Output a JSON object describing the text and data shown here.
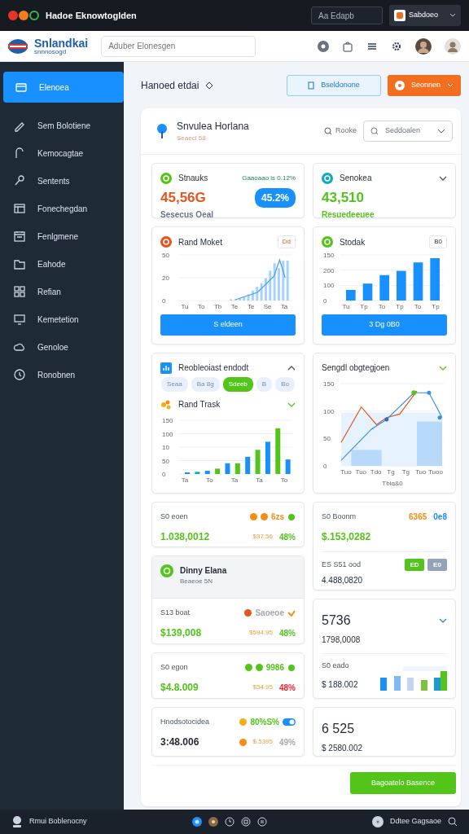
{
  "titlebar": {
    "title": "Hadoe Eknowtoglden",
    "search": {
      "placeholder": "Aa Edapb"
    },
    "account": "Sabdoeo"
  },
  "header": {
    "brand": "Snlandkai",
    "tagline": "snnnosogd",
    "search": {
      "placeholder": "Aduber Elonesgen"
    }
  },
  "sidebar": {
    "items": [
      {
        "label": "Elenoea",
        "selected": true
      },
      {
        "label": "Sem Bolotiene",
        "selected": false
      },
      {
        "label": "Kemocagtae",
        "selected": false
      },
      {
        "label": "Sentents",
        "selected": false
      },
      {
        "label": "Fonechegdan",
        "selected": false
      },
      {
        "label": "Fenlgmene",
        "selected": false
      },
      {
        "label": "Eahode",
        "selected": false
      },
      {
        "label": "Refian",
        "selected": false
      },
      {
        "label": "Kemetetion",
        "selected": false
      },
      {
        "label": "Genoloe",
        "selected": false
      },
      {
        "label": "Ronobnen",
        "selected": false
      }
    ]
  },
  "page": {
    "title": "Hanoed etdai",
    "secondary_button": "Bseldonone",
    "primary_button": "Seonnen"
  },
  "panel": {
    "title": "Snvulea Horlana",
    "subtitle": "Seaecl 58",
    "link": "Rooke",
    "select": "Seddoalen"
  },
  "stats": [
    {
      "title": "Stnauks",
      "color": "#52c41a",
      "note": "Gaaoaao is 0.12%",
      "value": {
        "text": "45,56G",
        "color": "#e8541e"
      },
      "pill": "45.2%",
      "caption": {
        "text": "Sesecus Oeal",
        "color": "#6b7280"
      },
      "expandable": false
    },
    {
      "title": "Senokea",
      "color": "#13a8c2",
      "value": {
        "text": "43,510",
        "color": "#52c41a"
      },
      "caption": {
        "text": "Resuedeeuee",
        "color": "#52c41a"
      },
      "expandable": true
    }
  ],
  "chart_cards": [
    {
      "title": "Rand Moket",
      "color": "#e8541e",
      "tag": "Dd",
      "kind": "area",
      "y_labels": [
        "50",
        "20",
        "0"
      ],
      "x_labels": [
        "Tu",
        "To",
        "Tb",
        "Te",
        "Te",
        "Se",
        "Ta"
      ],
      "button": "S eldeen"
    },
    {
      "title": "Stodak",
      "color": "#52c41a",
      "tag": "B0",
      "kind": "bar",
      "y_labels": [
        "150",
        "200",
        "100",
        "0"
      ],
      "x_labels": [
        "Tu",
        "Tp",
        "To",
        "Tp",
        "To",
        "Tp"
      ],
      "button": "3 Dg 0B0"
    }
  ],
  "report": {
    "title": "Reobleoiast endodt",
    "filters": [
      {
        "label": "Seaa",
        "selected": false
      },
      {
        "label": "Ba 8g",
        "selected": false
      },
      {
        "label": "Sdeeb",
        "selected": true
      },
      {
        "label": "B",
        "selected": false
      },
      {
        "label": "Bo",
        "selected": false
      }
    ],
    "subtitle": "Rand Trask",
    "y_labels": [
      "150",
      "100",
      "10",
      "50",
      "0"
    ],
    "x_labels": [
      "Ta",
      "To",
      "Ta",
      "Ta",
      "To"
    ]
  },
  "trend": {
    "title": "Sengdl obgtegjoen",
    "y_labels": [
      "150",
      "100",
      "50",
      "0"
    ],
    "x_labels": [
      "Tuo",
      "Tuo",
      "Tdo",
      "Tg",
      "Tg",
      "Tuo",
      "Tuoo"
    ],
    "x_title": "Tbig&0"
  },
  "left_tiles": [
    {
      "kind": "stat",
      "label": "S0 eoen",
      "dots": [
        {
          "color": "#fa8c16"
        },
        {
          "color": "#fa8c16"
        }
      ],
      "tag": {
        "text": "6zs",
        "color": "#fa8c16"
      },
      "trail": {
        "kind": "leaf",
        "color": "#52c41a"
      },
      "value": {
        "text": "1.038,0012",
        "color": "#52c41a"
      },
      "amount": "$37.56",
      "percent": {
        "text": "48%",
        "color": "#52c41a"
      }
    },
    {
      "kind": "group",
      "heading": "Dinny Elana",
      "subheading": "Beaeoe 5N",
      "label": "S13 boat",
      "dots": [
        {
          "color": "#e8541e"
        }
      ],
      "tag": {
        "text": "Saoeoe",
        "color": "#a3a9b3"
      },
      "trail": {
        "kind": "check",
        "color": "#fa8c16"
      },
      "value": {
        "text": "$139,008",
        "color": "#52c41a"
      },
      "amount": "$594.95",
      "percent": {
        "text": "48%",
        "color": "#52c41a"
      }
    },
    {
      "kind": "stat",
      "label": "S0 egon",
      "dots": [
        {
          "color": "#52c41a"
        },
        {
          "color": "#52c41a"
        }
      ],
      "tag": {
        "text": "9986",
        "color": "#52c41a"
      },
      "trail": {
        "kind": "leaf",
        "color": "#52c41a"
      },
      "value": {
        "text": "$4.8.009",
        "color": "#52c41a"
      },
      "amount": "$54.95",
      "percent": {
        "text": "48%",
        "color": "#f5222d"
      }
    },
    {
      "kind": "stat",
      "label": "Hnodsotocidea",
      "dots": [
        {
          "color": "#faad14"
        }
      ],
      "tag": {
        "text": "80%S%",
        "color": "#52c41a"
      },
      "trail": {
        "kind": "toggle",
        "color": "#1890ff"
      },
      "value": {
        "text": "3:48.006",
        "color": "#1f2937"
      },
      "amount_dot": {
        "color": "#fa8c16"
      },
      "amount": "$.5395",
      "percent": {
        "text": "49%",
        "color": "#a3a9b3"
      }
    }
  ],
  "right_tiles": [
    {
      "kind": "split",
      "label": "S0 Boonm",
      "tags": [
        {
          "text": "6365",
          "color": "#fa8c16"
        },
        {
          "text": "0e8",
          "color": "#1890ff"
        }
      ],
      "value": {
        "text": "$.153,0282",
        "color": "#52c41a"
      },
      "label_2": "ES S51 ood",
      "buttons": [
        {
          "text": "ED",
          "color": "#52c41a"
        },
        {
          "text": "E0",
          "color": "#94a3b8"
        }
      ],
      "value_2": "4.488,0820"
    },
    {
      "kind": "combo",
      "title": "5736",
      "value": "1798,0008",
      "expandable": true,
      "label_2": "S0 eado",
      "value_2": "$ 188.002"
    },
    {
      "kind": "big",
      "title": "6 525",
      "value": "$ 2580.002",
      "expandable": false
    }
  ],
  "action_button": "Bagoatelo Basence",
  "footer": {
    "user": "Rmui Boblenocny",
    "status": "Ddtee Gagsaoe"
  }
}
